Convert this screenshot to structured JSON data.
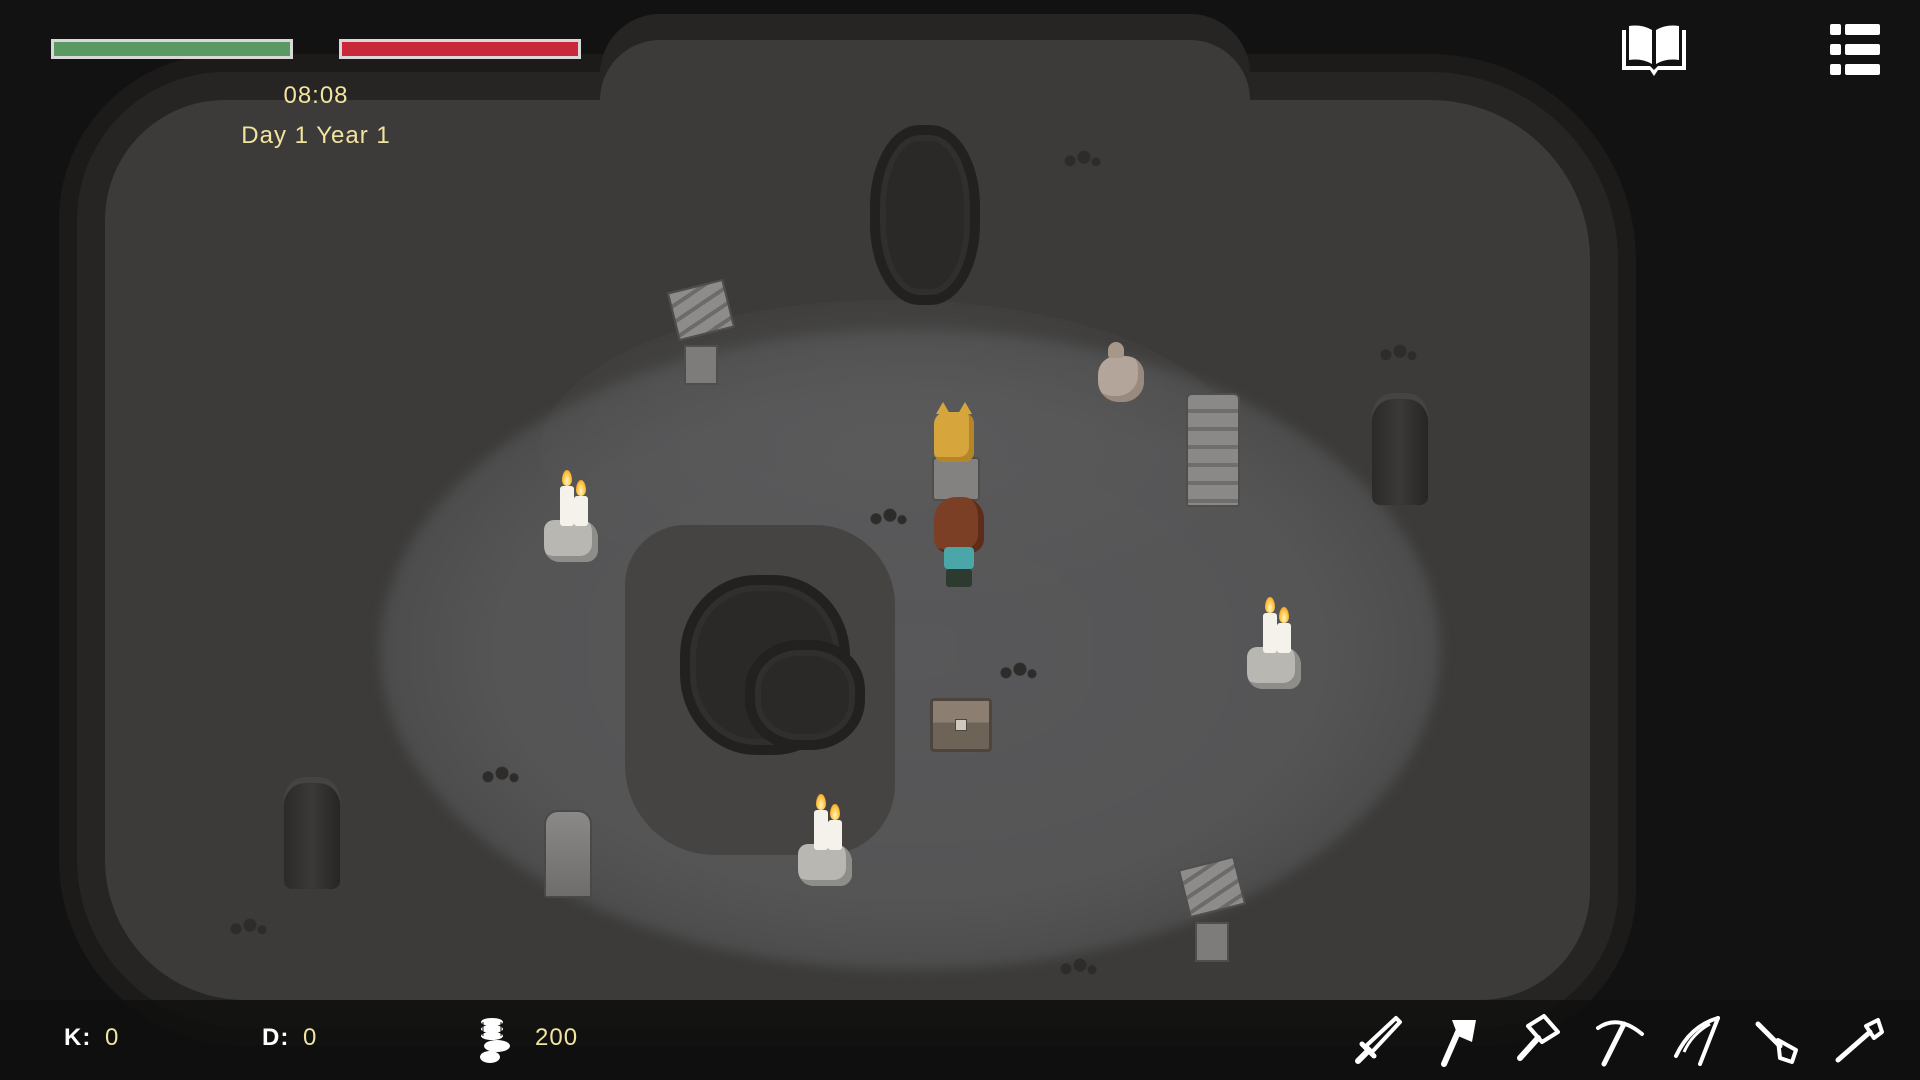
{
  "hud": {
    "health_fill": 1.0,
    "stamina_fill": 1.0,
    "colors": {
      "health": "#5a9a62",
      "stamina": "#c8283a",
      "text": "#f1e3a0"
    },
    "time": "08:08",
    "date": "Day 1 Year 1",
    "journal_icon": "book-icon",
    "menu_icon": "list-menu-icon"
  },
  "stats": {
    "kills_label": "K:",
    "kills_value": "0",
    "deaths_label": "D:",
    "deaths_value": "0",
    "coins_icon": "coin-stack-icon",
    "coins_value": "200"
  },
  "toolbar": {
    "tools": [
      {
        "name": "sword-icon"
      },
      {
        "name": "axe-icon"
      },
      {
        "name": "hammer-icon"
      },
      {
        "name": "pickaxe-icon"
      },
      {
        "name": "scythe-icon"
      },
      {
        "name": "shovel-icon"
      },
      {
        "name": "hoe-icon"
      }
    ]
  }
}
